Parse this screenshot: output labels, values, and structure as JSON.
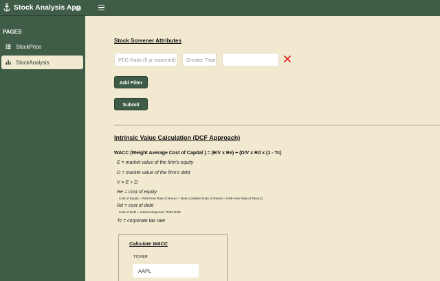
{
  "app": {
    "title": "Stock Analysis App"
  },
  "sidebar": {
    "heading": "PAGES",
    "items": [
      {
        "label": "StockPrice",
        "icon": "table-icon",
        "active": false
      },
      {
        "label": "StockAnalysis",
        "icon": "bar-chart-icon",
        "active": true
      }
    ]
  },
  "screener": {
    "title": "Stock Screener Attributes",
    "metric_placeholder": "PEG Ratio (5 yr expected)",
    "comparator_placeholder": "Greater Than",
    "value": "",
    "add_filter_label": "Add Filter",
    "submit_label": "Submit"
  },
  "dcf": {
    "title": "Intrinsic Value Calculation (DCF Approach)",
    "wacc_formula": "WACC (Weight Average Cost of Capital ) = (E/V x Re) + (D/V x Rd x (1 - Tc)",
    "lines": {
      "e": "E = market value of the firm's equity",
      "d": "D = market value of the firm's debt",
      "v": "V = E + D",
      "re": "Re = cost of equity",
      "re_sub": "Cost of Equity = Risk-Free Rate of Return + Beta x (Market Rate of Return – Risk-Free Rate of Return)",
      "rd": "Rd = cost of debt",
      "rd_sub": "Cost of Debt = Interest Expense / Total Debt",
      "tc": "Tc = corporate tax rate"
    },
    "calc": {
      "title": "Calculate WACC",
      "ticker_label": "TICKER",
      "ticker_value": "AAPL"
    }
  },
  "colors": {
    "sidebar": "#3e5c46",
    "background": "#f1ead1",
    "remove": "#e0241e"
  }
}
